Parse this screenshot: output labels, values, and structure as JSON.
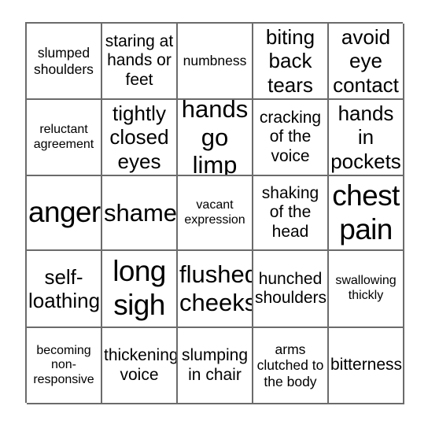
{
  "card": {
    "type": "bingo-card",
    "columns": 5,
    "rows": 5,
    "border_color": "#6b6b6b",
    "background_color": "#ffffff",
    "text_color": "#000000",
    "cells": [
      [
        {
          "text": "slumped shoulders",
          "size": "sm"
        },
        {
          "text": "staring at hands or feet",
          "size": "md"
        },
        {
          "text": "numbness",
          "size": "sm"
        },
        {
          "text": "biting back tears",
          "size": "lg"
        },
        {
          "text": "avoid eye contact",
          "size": "lg"
        }
      ],
      [
        {
          "text": "reluctant agreement",
          "size": "xs"
        },
        {
          "text": "tightly closed eyes",
          "size": "lg"
        },
        {
          "text": "hands go limp",
          "size": "xl"
        },
        {
          "text": "cracking of the voice",
          "size": "md"
        },
        {
          "text": "hands in pockets",
          "size": "lg"
        }
      ],
      [
        {
          "text": "anger",
          "size": "xxl"
        },
        {
          "text": "shame",
          "size": "xl"
        },
        {
          "text": "vacant expression",
          "size": "xs"
        },
        {
          "text": "shaking of the head",
          "size": "md"
        },
        {
          "text": "chest pain",
          "size": "xxl"
        }
      ],
      [
        {
          "text": "self-loathing",
          "size": "lg"
        },
        {
          "text": "long sigh",
          "size": "xxl"
        },
        {
          "text": "flushed cheeks",
          "size": "xl"
        },
        {
          "text": "hunched shoulders",
          "size": "md"
        },
        {
          "text": "swallowing thickly",
          "size": "xs"
        }
      ],
      [
        {
          "text": "becoming non-responsive",
          "size": "xs"
        },
        {
          "text": "thickening voice",
          "size": "md"
        },
        {
          "text": "slumping in chair",
          "size": "md"
        },
        {
          "text": "arms clutched to the body",
          "size": "sm"
        },
        {
          "text": "bitterness",
          "size": "md"
        }
      ]
    ]
  }
}
